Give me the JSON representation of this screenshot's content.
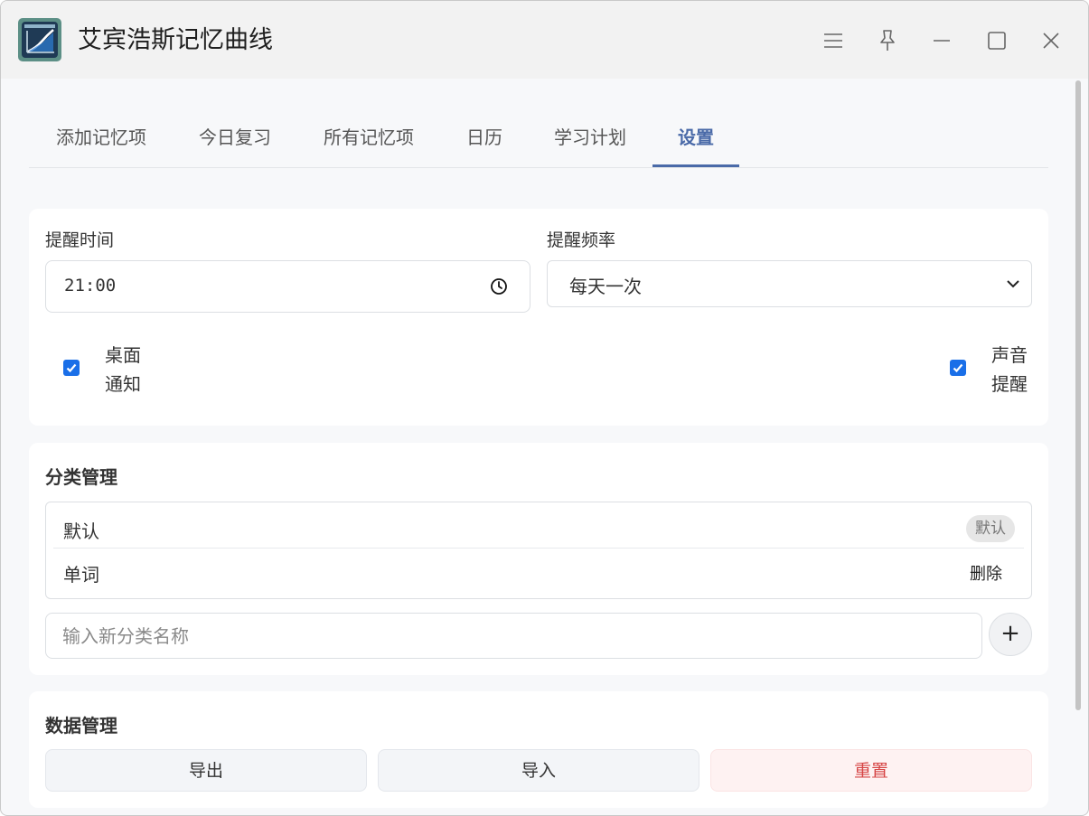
{
  "app": {
    "title": "艾宾浩斯记忆曲线",
    "icon": "memory-curve-app-icon"
  },
  "window_controls": [
    "menu-icon",
    "pin-icon",
    "minimize-icon",
    "maximize-icon",
    "close-icon"
  ],
  "tabs": [
    {
      "label": "添加记忆项",
      "active": false
    },
    {
      "label": "今日复习",
      "active": false
    },
    {
      "label": "所有记忆项",
      "active": false
    },
    {
      "label": "日历",
      "active": false
    },
    {
      "label": "学习计划",
      "active": false
    },
    {
      "label": "设置",
      "active": true
    }
  ],
  "reminder": {
    "time_label": "提醒时间",
    "time_value": "21:00",
    "frequency_label": "提醒频率",
    "frequency_value": "每天一次",
    "desktop_notify_line1": "桌面",
    "desktop_notify_line2": "通知",
    "desktop_notify_checked": true,
    "sound_line1": "声音",
    "sound_line2": "提醒",
    "sound_checked": true
  },
  "categories": {
    "title": "分类管理",
    "items": [
      {
        "name": "默认",
        "badge": "默认"
      },
      {
        "name": "单词",
        "action": "删除"
      }
    ],
    "new_placeholder": "输入新分类名称",
    "add_label": "+"
  },
  "data_management": {
    "title": "数据管理",
    "export_label": "导出",
    "import_label": "导入",
    "reset_label": "重置"
  },
  "colors": {
    "accent": "#4a6aa8",
    "checkbox": "#1a6fe8",
    "danger": "#d64545"
  }
}
